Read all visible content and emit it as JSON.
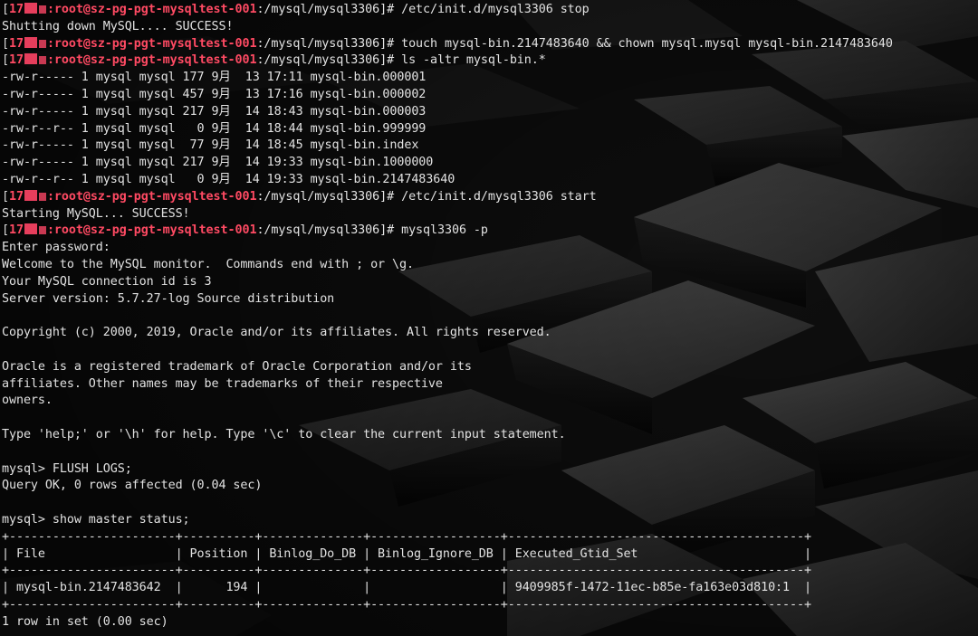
{
  "colors": {
    "prompt_accent": "#ff4a63",
    "text": "#e2e2e2",
    "background": "#0c0c0c"
  },
  "prompt": {
    "ip_prefix": "17",
    "host": ":root@sz-pg-pgt-mysqltest-001",
    "path": ":/mysql/mysql3306]",
    "symbol": "# "
  },
  "session": [
    {
      "type": "cmd",
      "command": "/etc/init.d/mysql3306 stop"
    },
    {
      "type": "out",
      "text": "Shutting down MySQL.... SUCCESS!"
    },
    {
      "type": "cmd",
      "command": "touch mysql-bin.2147483640 && chown mysql.mysql mysql-bin.2147483640"
    },
    {
      "type": "cmd",
      "command": "ls -altr mysql-bin.*"
    },
    {
      "type": "out",
      "text": "-rw-r----- 1 mysql mysql 177 9月  13 17:11 mysql-bin.000001"
    },
    {
      "type": "out",
      "text": "-rw-r----- 1 mysql mysql 457 9月  13 17:16 mysql-bin.000002"
    },
    {
      "type": "out",
      "text": "-rw-r----- 1 mysql mysql 217 9月  14 18:43 mysql-bin.000003"
    },
    {
      "type": "out",
      "text": "-rw-r--r-- 1 mysql mysql   0 9月  14 18:44 mysql-bin.999999"
    },
    {
      "type": "out",
      "text": "-rw-r----- 1 mysql mysql  77 9月  14 18:45 mysql-bin.index"
    },
    {
      "type": "out",
      "text": "-rw-r----- 1 mysql mysql 217 9月  14 19:33 mysql-bin.1000000"
    },
    {
      "type": "out",
      "text": "-rw-r--r-- 1 mysql mysql   0 9月  14 19:33 mysql-bin.2147483640"
    },
    {
      "type": "cmd",
      "command": "/etc/init.d/mysql3306 start"
    },
    {
      "type": "out",
      "text": "Starting MySQL... SUCCESS!"
    },
    {
      "type": "cmd",
      "command": "mysql3306 -p"
    },
    {
      "type": "out",
      "text": "Enter password:"
    },
    {
      "type": "out",
      "text": "Welcome to the MySQL monitor.  Commands end with ; or \\g."
    },
    {
      "type": "out",
      "text": "Your MySQL connection id is 3"
    },
    {
      "type": "out",
      "text": "Server version: 5.7.27-log Source distribution"
    },
    {
      "type": "out",
      "text": ""
    },
    {
      "type": "out",
      "text": "Copyright (c) 2000, 2019, Oracle and/or its affiliates. All rights reserved."
    },
    {
      "type": "out",
      "text": ""
    },
    {
      "type": "out",
      "text": "Oracle is a registered trademark of Oracle Corporation and/or its"
    },
    {
      "type": "out",
      "text": "affiliates. Other names may be trademarks of their respective"
    },
    {
      "type": "out",
      "text": "owners."
    },
    {
      "type": "out",
      "text": ""
    },
    {
      "type": "out",
      "text": "Type 'help;' or '\\h' for help. Type '\\c' to clear the current input statement."
    },
    {
      "type": "out",
      "text": ""
    },
    {
      "type": "out",
      "text": "mysql> FLUSH LOGS;"
    },
    {
      "type": "out",
      "text": "Query OK, 0 rows affected (0.04 sec)"
    },
    {
      "type": "out",
      "text": ""
    },
    {
      "type": "out",
      "text": "mysql> show master status;"
    },
    {
      "type": "out",
      "text": "+-----------------------+----------+--------------+------------------+-----------------------------------------+"
    },
    {
      "type": "out",
      "text": "| File                  | Position | Binlog_Do_DB | Binlog_Ignore_DB | Executed_Gtid_Set                       |"
    },
    {
      "type": "out",
      "text": "+-----------------------+----------+--------------+------------------+-----------------------------------------+"
    },
    {
      "type": "out",
      "text": "| mysql-bin.2147483642  |      194 |              |                  | 9409985f-1472-11ec-b85e-fa163e03d810:1  |"
    },
    {
      "type": "out",
      "text": "+-----------------------+----------+--------------+------------------+-----------------------------------------+"
    },
    {
      "type": "out",
      "text": "1 row in set (0.00 sec)"
    }
  ]
}
